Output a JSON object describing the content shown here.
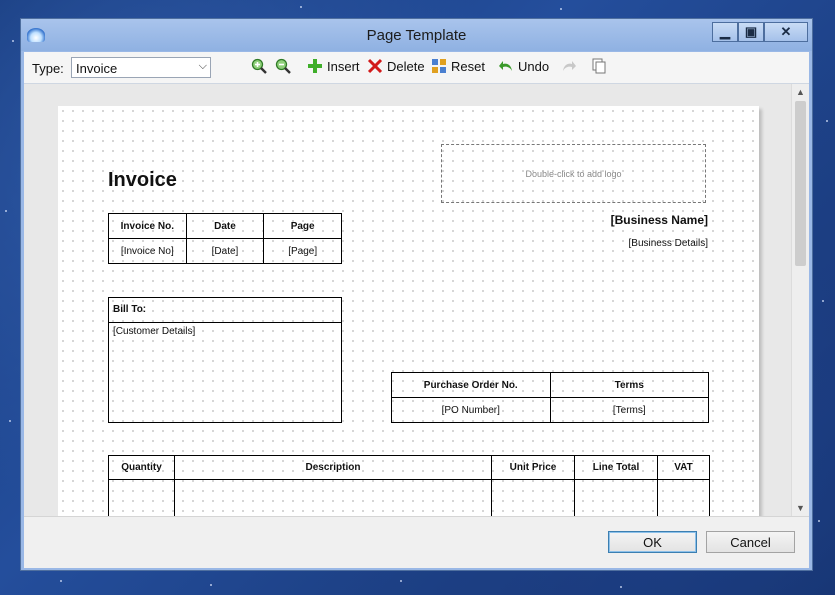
{
  "window": {
    "title": "Page Template"
  },
  "toolbar": {
    "type_label": "Type:",
    "type_value": "Invoice",
    "insert_label": "Insert",
    "delete_label": "Delete",
    "reset_label": "Reset",
    "undo_label": "Undo"
  },
  "document": {
    "title": "Invoice",
    "logo_hint": "Double-click to add logo",
    "business_name": "[Business Name]",
    "business_details": "[Business Details]",
    "invoice_table": {
      "headers": [
        "Invoice No.",
        "Date",
        "Page"
      ],
      "values": [
        "[Invoice No]",
        "[Date]",
        "[Page]"
      ]
    },
    "bill_to": {
      "label": "Bill To:",
      "value": "[Customer Details]"
    },
    "po_table": {
      "headers": [
        "Purchase Order No.",
        "Terms"
      ],
      "values": [
        "[PO Number]",
        "[Terms]"
      ]
    },
    "items_table": {
      "headers": [
        "Quantity",
        "Description",
        "Unit Price",
        "Line Total",
        "VAT"
      ]
    }
  },
  "footer": {
    "ok_label": "OK",
    "cancel_label": "Cancel"
  },
  "colors": {
    "accent": "#3c7fb1",
    "titlebar": "#9ab8e6"
  }
}
